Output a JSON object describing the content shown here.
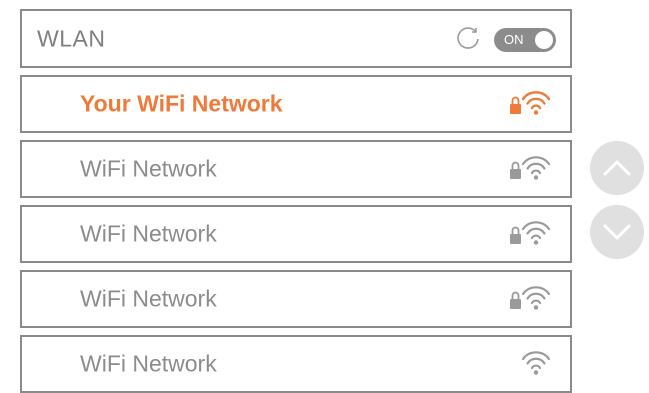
{
  "header": {
    "title": "WLAN",
    "toggle_label": "ON"
  },
  "networks": [
    {
      "name": "Your WiFi Network",
      "active": true,
      "locked": true
    },
    {
      "name": "WiFi Network",
      "active": false,
      "locked": true
    },
    {
      "name": "WiFi Network",
      "active": false,
      "locked": true
    },
    {
      "name": "WiFi Network",
      "active": false,
      "locked": true
    },
    {
      "name": "WiFi Network",
      "active": false,
      "locked": false
    }
  ],
  "icons": {
    "refresh": "refresh-icon",
    "wifi": "wifi-icon",
    "lock": "lock-icon",
    "scroll_up": "chevron-up-icon",
    "scroll_down": "chevron-down-icon"
  },
  "colors": {
    "accent": "#ef7a39",
    "muted_text": "#8c8c8c",
    "border": "#8a8a8a",
    "toggle": "#8c8c8c",
    "scroll_button": "#e0e0e0"
  }
}
